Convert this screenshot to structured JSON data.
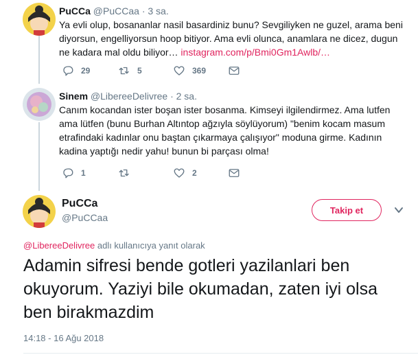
{
  "tweets": [
    {
      "name": "PuCCa",
      "handle": "@PuCCaa",
      "time": "· 3 sa.",
      "text": "Ya evli olup, bosananlar nasil basardiniz bunu? Sevgiliyken ne guzel, arama beni diyorsun, engelliyorsun hoop bitiyor. Ama evli olunca, anamlara ne dicez, dugun ne kadara mal oldu biliyor…",
      "link": "instagram.com/p/Bmi0Gm1Awlb/…",
      "replies": "29",
      "retweets": "5",
      "likes": "369"
    },
    {
      "name": "Sinem",
      "handle": "@LibereeDelivree",
      "time": "· 2 sa.",
      "text": "Canım kocandan ister boşan ister bosanma. Kimseyi ilgilendirmez. Ama lutfen ama lütfen (bunu Burhan Altıntop ağzıyla söylüyorum) \"benim kocam masum etrafindaki kadınlar onu baştan çıkarmaya çalışıyor\" moduna girme. Kadının kadina yaptığı nedir yahu! bunun bi parçası olma!",
      "replies": "1",
      "retweets": "",
      "likes": "2"
    }
  ],
  "main_tweet": {
    "name": "PuCCa",
    "handle": "@PuCCaa",
    "follow_label": "Takip et",
    "reply_mention": "@LibereeDelivree",
    "reply_suffix": " adlı kullanıcıya yanıt olarak",
    "text": "Adamin sifresi bende gotleri yazilanlari ben okuyorum. Yaziyi bile okumadan, zaten iyi olsa ben birakmazdim",
    "timestamp": "14:18 - 16 Ağu 2018"
  },
  "colors": {
    "accent": "#e0245e",
    "muted": "#657786",
    "text": "#14171a",
    "thread_line": "#ccd6dd"
  },
  "icons": [
    "reply-icon",
    "retweet-icon",
    "like-icon",
    "message-icon",
    "chevron-down-icon"
  ]
}
